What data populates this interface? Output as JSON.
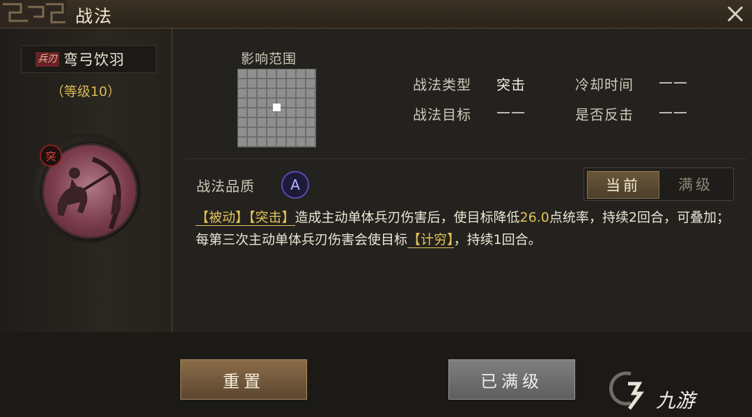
{
  "window": {
    "title": "战法"
  },
  "skill": {
    "type_badge": "兵刃",
    "name": "弯弓饮羽",
    "level": "（等级10）",
    "assault_badge": "突"
  },
  "range": {
    "label": "影响范围"
  },
  "info": {
    "type_label": "战法类型",
    "type_value": "突击",
    "target_label": "战法目标",
    "target_value": "——",
    "cooldown_label": "冷却时间",
    "cooldown_value": "——",
    "counter_label": "是否反击",
    "counter_value": "——"
  },
  "quality": {
    "label": "战法品质",
    "grade": "A"
  },
  "toggle": {
    "current": "当前",
    "max": "满级"
  },
  "description": {
    "p1": "【被动】",
    "p2": "【突击】",
    "p3": "造成主动单体兵刃伤害后，使目标降低",
    "p4": "26.0",
    "p5": "点统率，持续2回合，可叠加；每第三次主动单体兵刃伤害会使目标",
    "p6": "【计穷】",
    "p7": "，持续1回合。"
  },
  "buttons": {
    "reset": "重置",
    "maxed": "已满级"
  },
  "watermark": {
    "text": "九游"
  }
}
